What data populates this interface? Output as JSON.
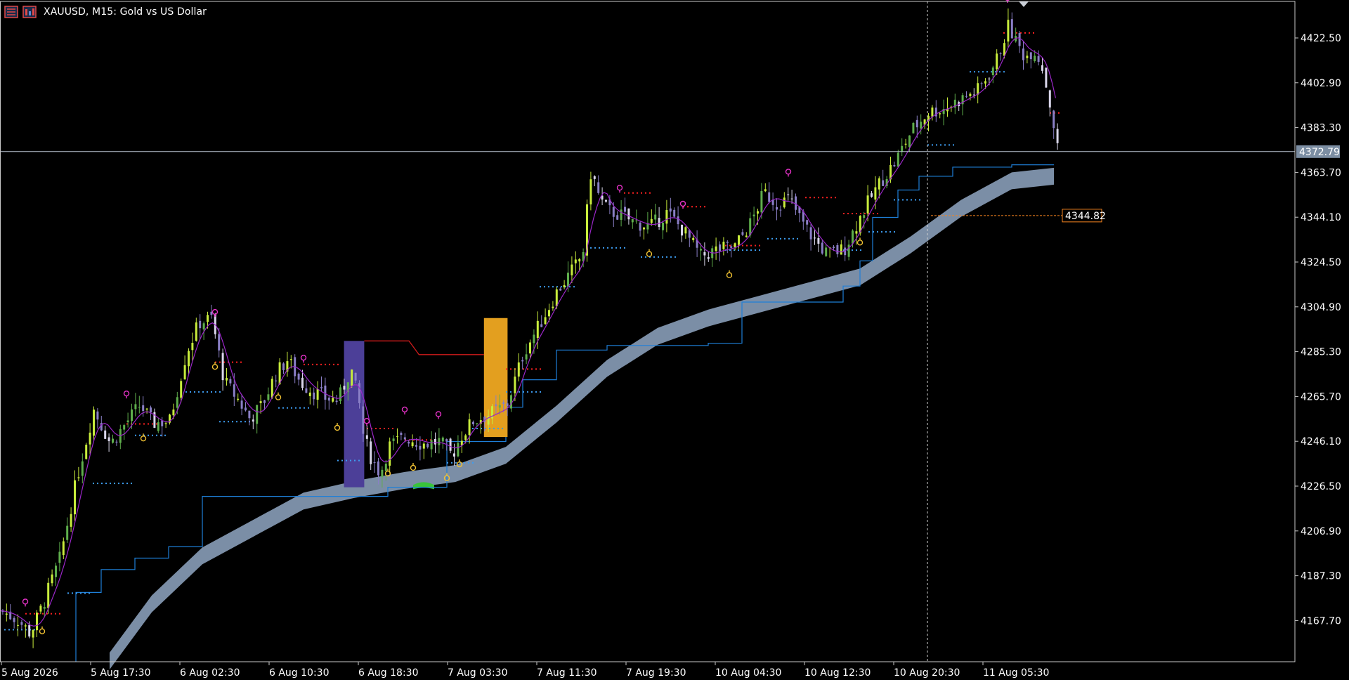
{
  "window": {
    "symbol_title": "XAUUSD, M15:  Gold vs US Dollar",
    "icons": [
      "chart-icon",
      "indicator-icon"
    ]
  },
  "colors": {
    "background": "#000000",
    "bull_candle": "#c8ec3c",
    "bull_candle_alt": "#5fae4c",
    "bear_candle": "#8a7fc6",
    "bear_candle_alt": "#d9d6ea",
    "ma_line": "#9b27c9",
    "ribbon": "#7b8ea6",
    "step_line": "#1e7fd8",
    "resistance_dots": "#ff2020",
    "support_dots": "#3d9cf0",
    "crosshair": "#b9c3d0",
    "price_tag_bg": "#7c8ea3",
    "order_line": "#f5841f",
    "purple_box": "#4c3f98",
    "orange_box": "#e39f1f",
    "red_level": "#d01c1c",
    "green_marker": "#39c33a"
  },
  "price_axis": {
    "labels": [
      "4422.50",
      "4402.90",
      "4383.30",
      "4363.70",
      "4344.10",
      "4324.50",
      "4304.90",
      "4285.30",
      "4265.70",
      "4246.10",
      "4226.50",
      "4206.90",
      "4187.30",
      "4167.70"
    ],
    "current_price": "4372.79",
    "order_price": "4344.82"
  },
  "time_axis": {
    "labels": [
      "5 Aug 2026",
      "5 Aug 17:30",
      "6 Aug 02:30",
      "6 Aug 10:30",
      "6 Aug 18:30",
      "7 Aug 03:30",
      "7 Aug 11:30",
      "7 Aug 19:30",
      "10 Aug 04:30",
      "10 Aug 12:30",
      "10 Aug 20:30",
      "11 Aug 05:30"
    ]
  },
  "chart_data": {
    "type": "candlestick",
    "symbol": "XAUUSD",
    "timeframe": "M15",
    "ylim": [
      4155,
      4434
    ],
    "close_path": [
      [
        0,
        4172
      ],
      [
        0.02,
        4168
      ],
      [
        0.035,
        4162
      ],
      [
        0.05,
        4175
      ],
      [
        0.07,
        4195
      ],
      [
        0.09,
        4230
      ],
      [
        0.11,
        4260
      ],
      [
        0.13,
        4245
      ],
      [
        0.15,
        4255
      ],
      [
        0.165,
        4262
      ],
      [
        0.18,
        4254
      ],
      [
        0.2,
        4255
      ],
      [
        0.22,
        4285
      ],
      [
        0.235,
        4298
      ],
      [
        0.25,
        4300
      ],
      [
        0.265,
        4272
      ],
      [
        0.28,
        4265
      ],
      [
        0.295,
        4256
      ],
      [
        0.31,
        4262
      ],
      [
        0.325,
        4275
      ],
      [
        0.34,
        4282
      ],
      [
        0.355,
        4272
      ],
      [
        0.37,
        4268
      ],
      [
        0.385,
        4265
      ],
      [
        0.4,
        4264
      ],
      [
        0.415,
        4278
      ],
      [
        0.425,
        4262
      ],
      [
        0.43,
        4248
      ],
      [
        0.44,
        4238
      ],
      [
        0.45,
        4232
      ],
      [
        0.46,
        4244
      ],
      [
        0.48,
        4248
      ],
      [
        0.5,
        4245
      ],
      [
        0.52,
        4246
      ],
      [
        0.535,
        4240
      ],
      [
        0.545,
        4248
      ],
      [
        0.56,
        4255
      ],
      [
        0.58,
        4258
      ],
      [
        0.6,
        4262
      ],
      [
        0.62,
        4285
      ],
      [
        0.64,
        4298
      ],
      [
        0.66,
        4312
      ],
      [
        0.68,
        4322
      ],
      [
        0.69,
        4328
      ],
      [
        0.7,
        4365
      ],
      [
        0.71,
        4352
      ],
      [
        0.72,
        4347
      ],
      [
        0.735,
        4345
      ],
      [
        0.75,
        4342
      ],
      [
        0.77,
        4340
      ],
      [
        0.79,
        4346
      ],
      [
        0.81,
        4338
      ],
      [
        0.83,
        4327
      ],
      [
        0.85,
        4330
      ],
      [
        0.87,
        4331
      ],
      [
        0.89,
        4342
      ],
      [
        0.905,
        4355
      ],
      [
        0.92,
        4350
      ],
      [
        0.935,
        4352
      ],
      [
        0.95,
        4342
      ],
      [
        0.965,
        4334
      ],
      [
        0.98,
        4328
      ],
      [
        1,
        4330
      ],
      [
        1.02,
        4345
      ],
      [
        1.04,
        4358
      ],
      [
        1.06,
        4368
      ],
      [
        1.08,
        4382
      ],
      [
        1.1,
        4390
      ],
      [
        1.12,
        4392
      ],
      [
        1.14,
        4396
      ],
      [
        1.16,
        4400
      ],
      [
        1.18,
        4412
      ],
      [
        1.195,
        4428
      ],
      [
        1.205,
        4420
      ],
      [
        1.215,
        4414
      ],
      [
        1.225,
        4418
      ],
      [
        1.235,
        4410
      ],
      [
        1.245,
        4392
      ],
      [
        1.255,
        4370
      ]
    ],
    "ribbon_path": [
      [
        0.13,
        4150
      ],
      [
        0.18,
        4175
      ],
      [
        0.24,
        4196
      ],
      [
        0.3,
        4208
      ],
      [
        0.36,
        4220
      ],
      [
        0.42,
        4225
      ],
      [
        0.48,
        4229
      ],
      [
        0.54,
        4232
      ],
      [
        0.6,
        4240
      ],
      [
        0.66,
        4258
      ],
      [
        0.72,
        4278
      ],
      [
        0.78,
        4292
      ],
      [
        0.84,
        4300
      ],
      [
        0.9,
        4306
      ],
      [
        0.96,
        4312
      ],
      [
        1.02,
        4318
      ],
      [
        1.08,
        4332
      ],
      [
        1.14,
        4348
      ],
      [
        1.2,
        4360
      ],
      [
        1.25,
        4362
      ]
    ],
    "step_levels": [
      [
        0.09,
        4155
      ],
      [
        0.12,
        4180
      ],
      [
        0.16,
        4190
      ],
      [
        0.2,
        4195
      ],
      [
        0.24,
        4200
      ],
      [
        0.29,
        4222
      ],
      [
        0.35,
        4222
      ],
      [
        0.4,
        4222
      ],
      [
        0.46,
        4222
      ],
      [
        0.53,
        4226
      ],
      [
        0.58,
        4246
      ],
      [
        0.6,
        4246
      ],
      [
        0.62,
        4261
      ],
      [
        0.66,
        4273
      ],
      [
        0.72,
        4286
      ],
      [
        0.77,
        4288
      ],
      [
        0.84,
        4288
      ],
      [
        0.88,
        4289
      ],
      [
        0.92,
        4307
      ],
      [
        0.95,
        4307
      ],
      [
        0.98,
        4307
      ],
      [
        1.0,
        4307
      ],
      [
        1.02,
        4314
      ],
      [
        1.035,
        4325
      ],
      [
        1.065,
        4344
      ],
      [
        1.09,
        4356
      ],
      [
        1.13,
        4362
      ],
      [
        1.2,
        4366
      ],
      [
        1.25,
        4367
      ]
    ],
    "boxes": [
      {
        "name": "purple-zone",
        "x0": 0.408,
        "x1": 0.432,
        "top": 4290,
        "bottom": 4226
      },
      {
        "name": "orange-zone",
        "x0": 0.574,
        "x1": 0.602,
        "top": 4300,
        "bottom": 4248
      }
    ]
  }
}
